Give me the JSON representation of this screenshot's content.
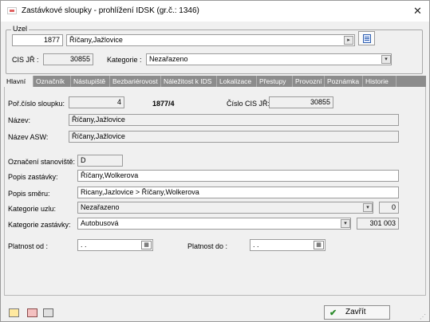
{
  "window": {
    "title": "Zastávkové sloupky - prohlížení  IDSK (gr.č.: 1346)",
    "close_glyph": "✕"
  },
  "uzel": {
    "group_label": "Uzel",
    "number": "1877",
    "name": "Říčany,Jažlovice",
    "cis_jr_label": "CIS JŘ :",
    "cis_jr_value": "30855",
    "kategorie_label": "Kategorie :",
    "kategorie_value": "Nezařazeno"
  },
  "tabs": [
    {
      "label": "Hlavní",
      "active": true
    },
    {
      "label": "Označník",
      "active": false
    },
    {
      "label": "Nástupiště",
      "active": false
    },
    {
      "label": "Bezbariérovost",
      "active": false
    },
    {
      "label": "Náležitost k IDS",
      "active": false
    },
    {
      "label": "Lokalizace",
      "active": false
    },
    {
      "label": "Přestupy",
      "active": false
    },
    {
      "label": "Provozní",
      "active": false
    },
    {
      "label": "Poznámka",
      "active": false
    },
    {
      "label": "Historie",
      "active": false
    }
  ],
  "form": {
    "por_cislo_label": "Poř.číslo sloupku:",
    "por_cislo_value": "4",
    "code_display": "1877/4",
    "cislo_cis_label": "Číslo CIS JŘ:",
    "cislo_cis_value": "30855",
    "nazev_label": "Název:",
    "nazev_value": "Říčany,Jažlovice",
    "nazev_asw_label": "Název ASW:",
    "nazev_asw_value": "Říčany,Jažlovice",
    "oznaceni_label": "Označení stanoviště:",
    "oznaceni_value": "D",
    "popis_zastavky_label": "Popis zastávky:",
    "popis_zastavky_value": "Říčany,Wolkerova",
    "popis_smeru_label": "Popis směru:",
    "popis_smeru_value": "Ricany,Jazlovice > Říčany,Wolkerova",
    "kategorie_uzlu_label": "Kategorie uzlu:",
    "kategorie_uzlu_value": "Nezařazeno",
    "kategorie_uzlu_code": "0",
    "kategorie_zastavky_label": "Kategorie zastávky:",
    "kategorie_zastavky_value": "Autobusová",
    "kategorie_zastavky_code": "301 003",
    "platnost_od_label": "Platnost od :",
    "platnost_od_value": ". .",
    "platnost_do_label": "Platnost do :",
    "platnost_do_value": ". ."
  },
  "footer": {
    "zavrit_label": "Zavřít",
    "buttons": [
      "add-record-icon",
      "edit-record-icon",
      "copy-record-icon"
    ]
  },
  "icons": {
    "ellipsis": "▸",
    "dropdown": "▾",
    "calendar": "▦",
    "check": "✔"
  }
}
